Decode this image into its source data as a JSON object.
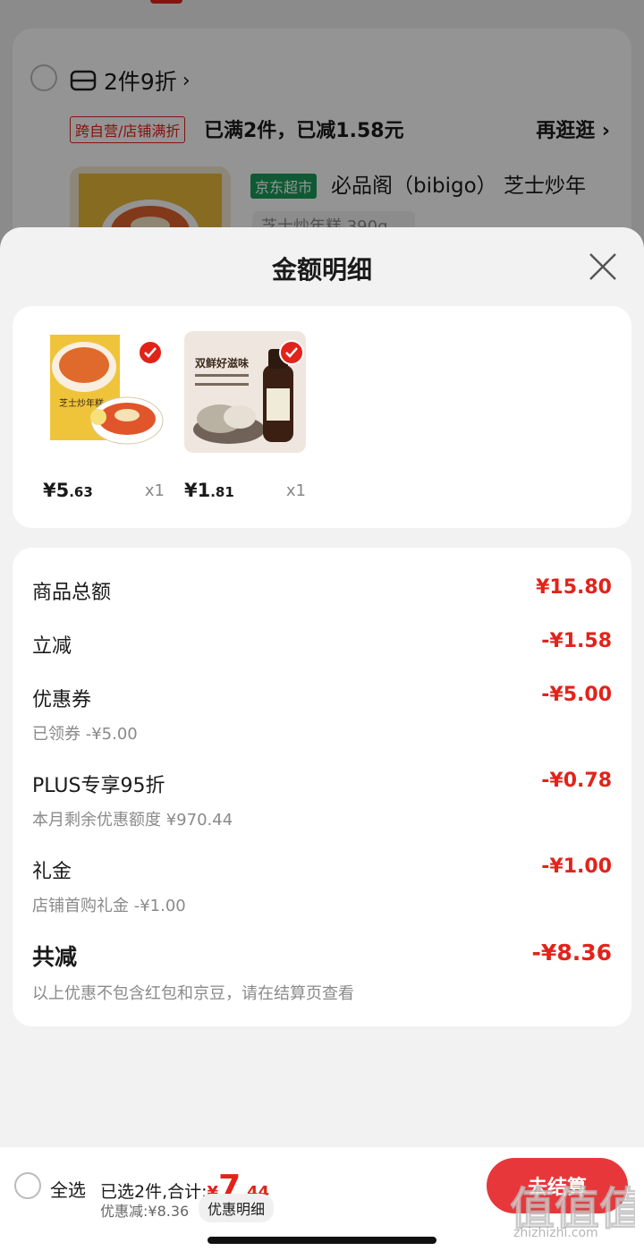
{
  "background": {
    "promo_label": "2件9折",
    "promo_chevron": "›",
    "tag": "跨自营/店铺满折",
    "promo_status": "已满2件，已减1.58元",
    "more_link": "再逛逛 ›",
    "badge": "京东超市",
    "product_title": "必品阁（bibigo） 芝士炒年",
    "spec": "芝士炒年糕 390g ⌄"
  },
  "sheet": {
    "title": "金额明细",
    "products": [
      {
        "price_int": "¥5",
        "price_dec": ".63",
        "qty": "x1",
        "img_caption": "芝士炒年糕"
      },
      {
        "price_int": "¥1",
        "price_dec": ".81",
        "qty": "x1",
        "img_caption": "双鲜好滋味"
      }
    ],
    "rows": [
      {
        "label": "商品总额",
        "amount": "¥15.80"
      },
      {
        "label": "立减",
        "amount": "-¥1.58"
      },
      {
        "label": "优惠券",
        "amount": "-¥5.00",
        "sub": "已领券 -¥5.00"
      },
      {
        "label": "PLUS专享95折",
        "amount": "-¥0.78",
        "sub": "本月剩余优惠额度 ¥970.44"
      },
      {
        "label": "礼金",
        "amount": "-¥1.00",
        "sub": "店铺首购礼金 -¥1.00"
      },
      {
        "label": "共减",
        "amount": "-¥8.36",
        "sub": "以上优惠不包含红包和京豆，请在结算页查看"
      }
    ]
  },
  "bottom_bar": {
    "select_all": "全选",
    "selected_prefix": "已选2件,合计:",
    "total_symbol": "¥",
    "total_int": "7",
    "total_dec": ".44",
    "saved": "优惠减:¥8.36",
    "detail_chip": "优惠明细",
    "checkout": "去结算",
    "watermark_site": "zhizhizhi.com"
  },
  "colors": {
    "accent": "#e2231a",
    "jd_green": "#1a9b5a"
  }
}
